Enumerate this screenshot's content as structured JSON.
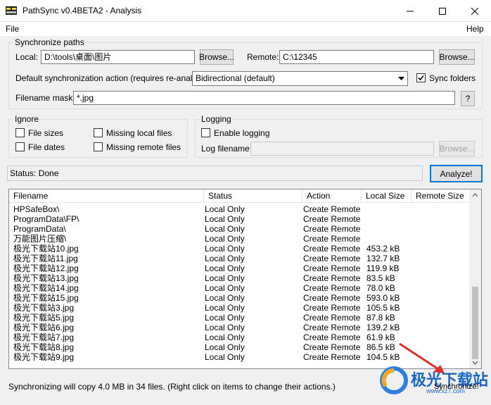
{
  "window": {
    "title": "PathSync v0.4BETA2 - Analysis",
    "minimize_glyph": "—",
    "maximize_glyph": "☐",
    "close_glyph": "✕"
  },
  "menu": {
    "file": "File",
    "help": "Help"
  },
  "sync_paths": {
    "legend": "Synchronize paths",
    "local_label": "Local:",
    "local_value": "D:\\tools\\桌面\\图片",
    "browse_local": "Browse...",
    "remote_label": "Remote:",
    "remote_value": "C:\\12345",
    "browse_remote": "Browse...",
    "action_label": "Default synchronization action (requires re-analyze):",
    "action_value": "Bidirectional (default)",
    "sync_folders_label": "Sync folders",
    "sync_folders_checked": true,
    "mask_label": "Filename mask:",
    "mask_value": "*.jpg",
    "help_button": "?"
  },
  "ignore": {
    "legend": "Ignore",
    "file_sizes": "File sizes",
    "missing_local": "Missing local files",
    "file_dates": "File dates",
    "missing_remote": "Missing remote files"
  },
  "logging": {
    "legend": "Logging",
    "enable_label": "Enable logging",
    "filename_label": "Log filename:",
    "browse": "Browse..."
  },
  "status": {
    "text": "Status: Done",
    "analyze_button": "Analyze!"
  },
  "list": {
    "headers": [
      "Filename",
      "Status",
      "Action",
      "Local Size",
      "Remote Size"
    ],
    "rows": [
      [
        "HPSafeBox\\",
        "Local Only",
        "Create Remote",
        ""
      ],
      [
        "ProgramData\\FP\\",
        "Local Only",
        "Create Remote",
        ""
      ],
      [
        "ProgramData\\",
        "Local Only",
        "Create Remote",
        ""
      ],
      [
        "万能图片压缩\\",
        "Local Only",
        "Create Remote",
        ""
      ],
      [
        "极光下载站10.jpg",
        "Local Only",
        "Create Remote",
        "453.2 kB"
      ],
      [
        "极光下载站11.jpg",
        "Local Only",
        "Create Remote",
        "132.7 kB"
      ],
      [
        "极光下载站12.jpg",
        "Local Only",
        "Create Remote",
        "119.9 kB"
      ],
      [
        "极光下载站13.jpg",
        "Local Only",
        "Create Remote",
        "83.5 kB"
      ],
      [
        "极光下载站14.jpg",
        "Local Only",
        "Create Remote",
        "78.0 kB"
      ],
      [
        "极光下载站15.jpg",
        "Local Only",
        "Create Remote",
        "593.0 kB"
      ],
      [
        "极光下载站3.jpg",
        "Local Only",
        "Create Remote",
        "105.5 kB"
      ],
      [
        "极光下载站5.jpg",
        "Local Only",
        "Create Remote",
        "87.8 kB"
      ],
      [
        "极光下载站6.jpg",
        "Local Only",
        "Create Remote",
        "139.2 kB"
      ],
      [
        "极光下载站7.jpg",
        "Local Only",
        "Create Remote",
        "61.9 kB"
      ],
      [
        "极光下载站8.jpg",
        "Local Only",
        "Create Remote",
        "86.5 kB"
      ],
      [
        "极光下载站9.jpg",
        "Local Only",
        "Create Remote",
        "104.5 kB"
      ]
    ]
  },
  "footer": {
    "summary": "Synchronizing will copy 4.0 MB in 34 files. (Right click on items to change their actions.)",
    "sync_button": "Synchronize!"
  },
  "watermark": {
    "text": "极光下载站",
    "sub": "www.xz7.com"
  }
}
